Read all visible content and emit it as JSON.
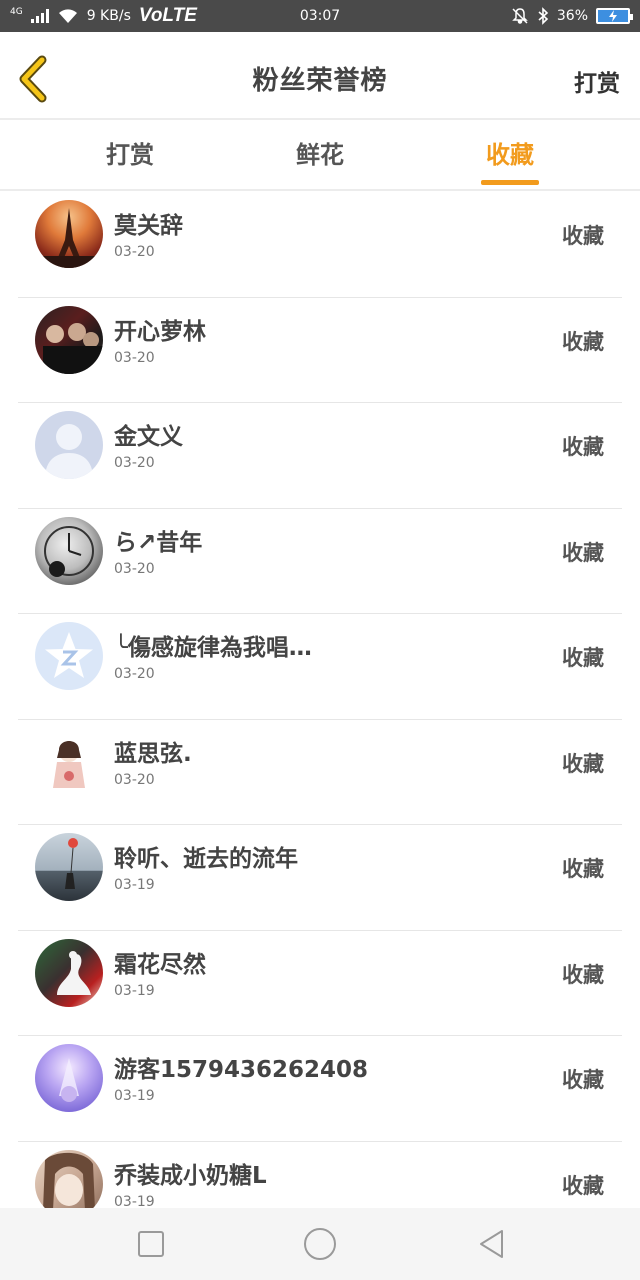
{
  "status_bar": {
    "network": "4G",
    "speed": "9 KB/s",
    "volte": "VoLTE",
    "time": "03:07",
    "battery": "36%"
  },
  "header": {
    "title": "粉丝荣誉榜",
    "action": "打赏"
  },
  "tabs": [
    "打赏",
    "鲜花",
    "收藏"
  ],
  "active_tab": 2,
  "accent_color": "#f29b1d",
  "rows": [
    {
      "name": "莫关辞",
      "date": "03-20",
      "action": "收藏"
    },
    {
      "name": "开心萝林",
      "date": "03-20",
      "action": "收藏"
    },
    {
      "name": "金文义",
      "date": "03-20",
      "action": "收藏"
    },
    {
      "name": "ら↗昔年",
      "date": "03-20",
      "action": "收藏"
    },
    {
      "name": "╰傷感旋律為我唱…",
      "date": "03-20",
      "action": "收藏"
    },
    {
      "name": "蓝思弦.",
      "date": "03-20",
      "action": "收藏"
    },
    {
      "name": "聆听、逝去的流年",
      "date": "03-19",
      "action": "收藏"
    },
    {
      "name": "霜花尽然",
      "date": "03-19",
      "action": "收藏"
    },
    {
      "name": "游客1579436262408",
      "date": "03-19",
      "action": "收藏"
    },
    {
      "name": "乔装成小奶糖L",
      "date": "03-19",
      "action": "收藏"
    }
  ]
}
